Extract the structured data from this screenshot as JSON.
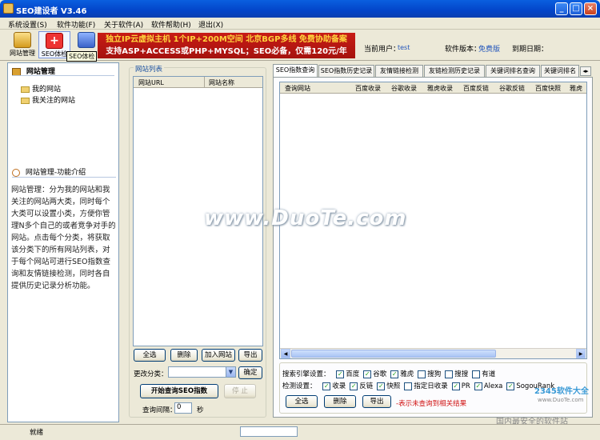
{
  "window": {
    "title": "SEO建设者 V3.46"
  },
  "menu": [
    "系统设置(S)",
    "软件功能(F)",
    "关于软件(A)",
    "软件帮助(H)",
    "退出(X)"
  ],
  "toolbar": {
    "buttons": [
      "网站管理",
      "SEO体检",
      "SEO体检"
    ],
    "tooltip": "SEO体检"
  },
  "banner": {
    "line1": "独立IP云虚拟主机 1个IP+200M空间 北京BGP多线 免费协助备案",
    "line2": "支持ASP+ACCESS或PHP+MYSQL；SEO必备，仅需120元/年"
  },
  "user_info": {
    "user_label": "当前用户：",
    "user": "test",
    "version_label": "软件版本：",
    "version": "免费版",
    "expire_label": "到期日期："
  },
  "left": {
    "header": "网站管理",
    "tree": [
      "我的网站",
      "我关注的网站"
    ],
    "intro_header": "网站管理-功能介绍",
    "intro_text": "网站管理：分为我的网站和我关注的网站两大类，同时每个大类可以设置小类，方便你管理N多个自己的或者竞争对手的网站。点击每个分类，将获取该分类下的所有网站列表，对于每个网站可进行SEO指数查询和友情链接检测，同时各自提供历史记录分析功能。"
  },
  "middle": {
    "group_label": "网站列表",
    "columns": [
      "网站URL",
      "网站名称"
    ],
    "buttons": [
      "全选",
      "删除",
      "加入网站",
      "导出"
    ],
    "category_label": "更改分类：",
    "category_value": "",
    "confirm": "确定",
    "start": "开始查询SEO指数",
    "stop": "停 止",
    "interval_label": "查询间隔：",
    "interval_value": "0",
    "interval_unit": "秒"
  },
  "right": {
    "tabs": [
      "SEO指数查询",
      "SEO指数历史记录",
      "友情链接检测",
      "友链检测历史记录",
      "关键词排名查询",
      "关键词排名"
    ],
    "columns": [
      "查询网站",
      "百度收录",
      "谷歌收录",
      "雅虎收录",
      "百度反链",
      "谷歌反链",
      "百度快照",
      "雅虎"
    ],
    "engine_label": "搜索引擎设置：",
    "engines": [
      {
        "label": "百度",
        "checked": true
      },
      {
        "label": "谷歌",
        "checked": true
      },
      {
        "label": "雅虎",
        "checked": true
      },
      {
        "label": "搜狗",
        "checked": false
      },
      {
        "label": "搜搜",
        "checked": false
      },
      {
        "label": "有道",
        "checked": false
      }
    ],
    "detect_label": "检测设置：",
    "detects": [
      {
        "label": "收录",
        "checked": true
      },
      {
        "label": "反链",
        "checked": true
      },
      {
        "label": "快照",
        "checked": true
      },
      {
        "label": "指定日收录",
        "checked": false
      },
      {
        "label": "PR",
        "checked": true
      },
      {
        "label": "Alexa",
        "checked": true
      },
      {
        "label": "SogouRank",
        "checked": true
      }
    ],
    "buttons": [
      "全选",
      "删除",
      "导出"
    ],
    "note": "-表示未查询到相关结果"
  },
  "status": {
    "text": "就绪"
  },
  "watermark": {
    "main": "www.DuoTe.com",
    "corner": "国内最安全的软件站",
    "logo": "2345软件大全",
    "logo_url": "www.DuoTe.com"
  },
  "colors": {
    "title": "#0345c9",
    "banner": "#c81c16",
    "note": "#d01010"
  }
}
